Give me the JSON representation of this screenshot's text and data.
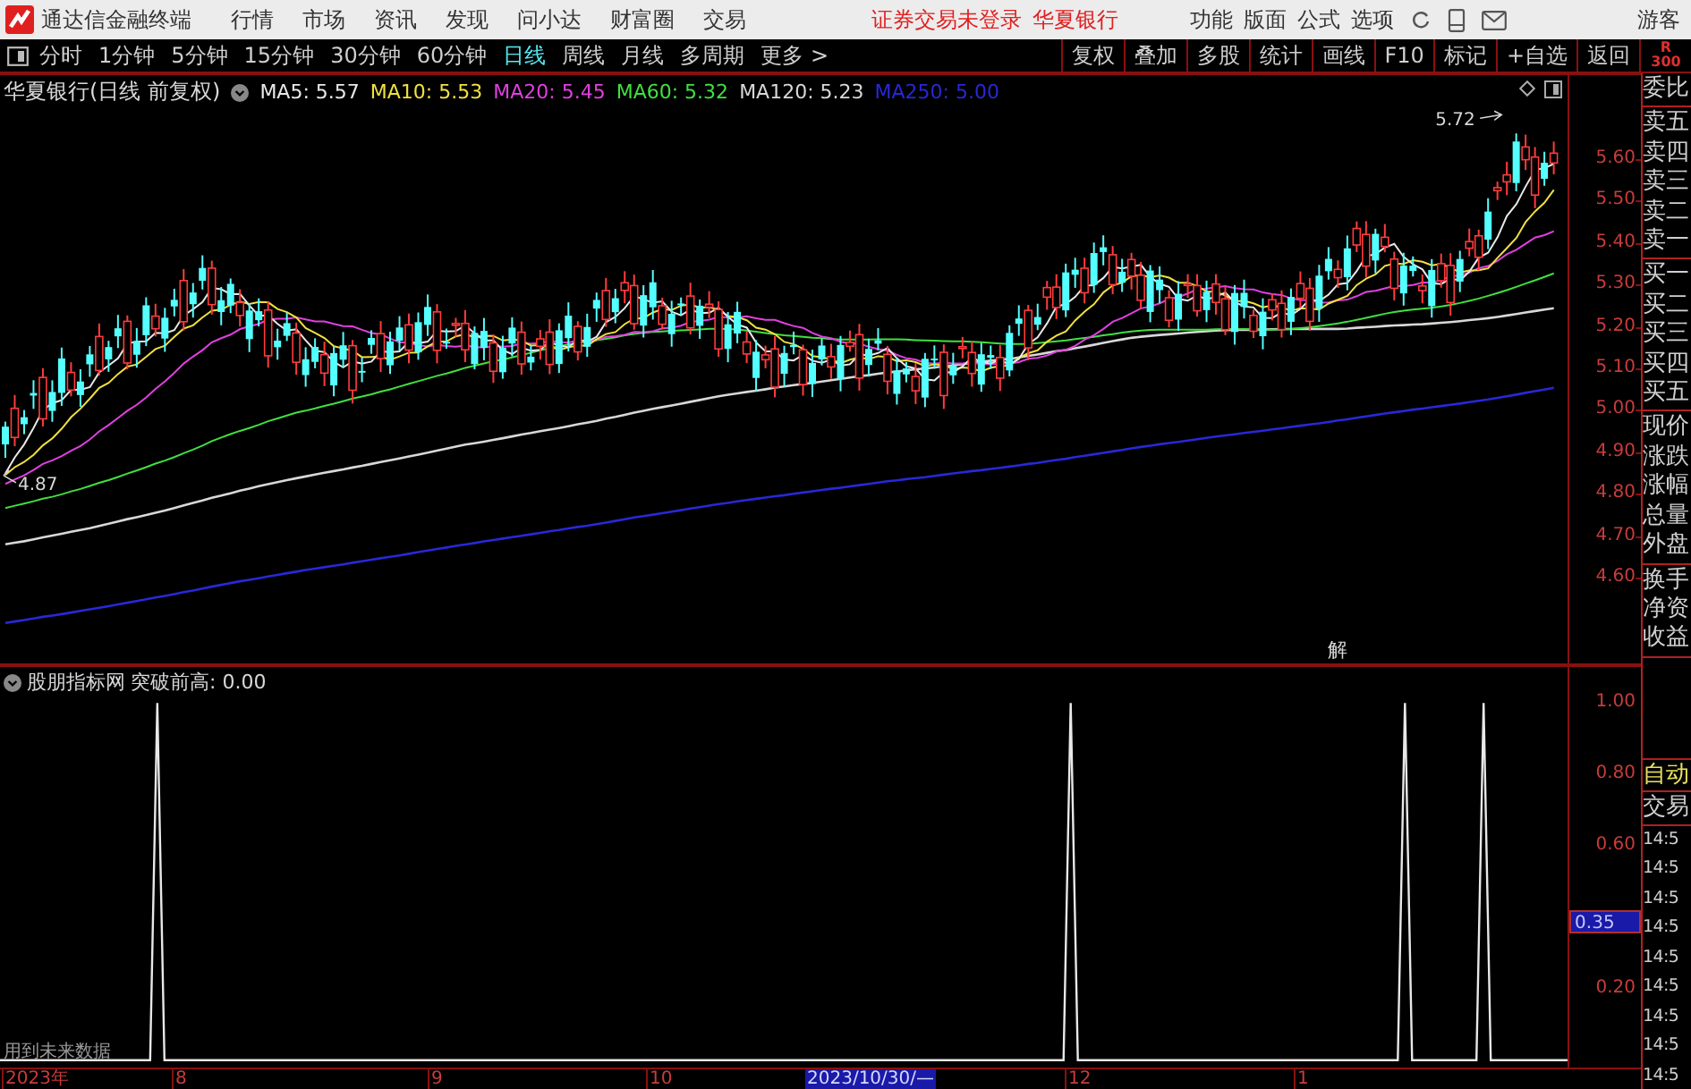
{
  "app": {
    "title": "通达信金融终端",
    "menu": [
      "行情",
      "市场",
      "资讯",
      "发现",
      "问小达",
      "财富圈",
      "交易"
    ],
    "status": [
      "证券交易未登录",
      "华夏银行"
    ],
    "right_menu": [
      "功能",
      "版面",
      "公式",
      "选项"
    ],
    "user": "游客"
  },
  "toolbar": {
    "periods": [
      {
        "label": "分时",
        "selected": false
      },
      {
        "label": "1分钟",
        "selected": false
      },
      {
        "label": "5分钟",
        "selected": false
      },
      {
        "label": "15分钟",
        "selected": false
      },
      {
        "label": "30分钟",
        "selected": false
      },
      {
        "label": "60分钟",
        "selected": false
      },
      {
        "label": "日线",
        "selected": true
      },
      {
        "label": "周线",
        "selected": false
      },
      {
        "label": "月线",
        "selected": false
      },
      {
        "label": "多周期",
        "selected": false
      },
      {
        "label": "更多 >",
        "selected": false
      }
    ],
    "tools": [
      "复权",
      "叠加",
      "多股",
      "统计",
      "画线",
      "F10",
      "标记",
      "+自选",
      "返回"
    ],
    "rating": [
      "R",
      "300"
    ]
  },
  "chart": {
    "title": "华夏银行(日线 前复权)",
    "ma": [
      {
        "label": "MA5: 5.57",
        "color": "#e8e8e8"
      },
      {
        "label": "MA10: 5.53",
        "color": "#f0e040"
      },
      {
        "label": "MA20: 5.45",
        "color": "#e040e0"
      },
      {
        "label": "MA60: 5.32",
        "color": "#40e040"
      },
      {
        "label": "MA120: 5.23",
        "color": "#d8d8d8"
      },
      {
        "label": "MA250: 5.00",
        "color": "#2828d8"
      }
    ],
    "high_label": "5.72",
    "low_label": "4.87",
    "marker": "解",
    "price_ticks": [
      "5.60",
      "5.50",
      "5.40",
      "5.30",
      "5.20",
      "5.10",
      "5.00",
      "4.90",
      "4.80",
      "4.70",
      "4.60"
    ]
  },
  "indicator": {
    "source": "股朋指标网",
    "name": "突破前高: 0.00",
    "ticks": [
      "1.00",
      "0.80",
      "0.60",
      "0.20"
    ],
    "cursor_value": "0.35",
    "note": "用到未来数据"
  },
  "date_axis": [
    {
      "label": "2023年",
      "selected": false
    },
    {
      "label": "8",
      "selected": false
    },
    {
      "label": "9",
      "selected": false
    },
    {
      "label": "10",
      "selected": false
    },
    {
      "label": "2023/10/30/—",
      "selected": true
    },
    {
      "label": "12",
      "selected": false
    },
    {
      "label": "1",
      "selected": false
    }
  ],
  "side_panel": {
    "groups": [
      [
        "委比"
      ],
      [
        "卖五",
        "卖四",
        "卖三",
        "卖二",
        "卖一"
      ],
      [
        "买一",
        "买二",
        "买三",
        "买四",
        "买五"
      ],
      [
        "现价",
        "涨跌",
        "涨幅",
        "总量",
        "外盘"
      ],
      [
        "换手",
        "净资",
        "收益"
      ]
    ],
    "mode": "自动",
    "trade_label": "交易",
    "times": [
      "14:5",
      "14:5",
      "14:5",
      "14:5",
      "14:5",
      "14:5",
      "14:5",
      "14:5",
      "14:5"
    ]
  }
}
